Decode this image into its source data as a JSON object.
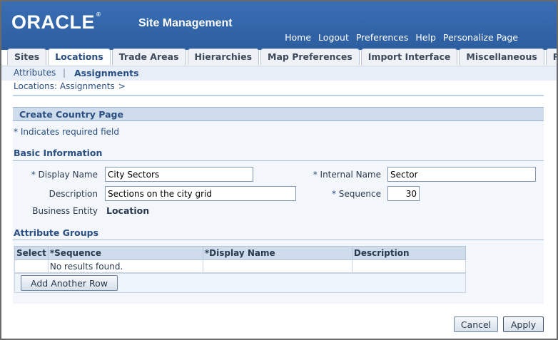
{
  "brand": {
    "logo": "ORACLE",
    "logo_mark": "®",
    "app_title": "Site Management"
  },
  "global_links": [
    "Home",
    "Logout",
    "Preferences",
    "Help",
    "Personalize Page"
  ],
  "tabs": [
    "Sites",
    "Locations",
    "Trade Areas",
    "Hierarchies",
    "Map Preferences",
    "Import Interface",
    "Miscellaneous",
    "Role Securit"
  ],
  "active_tab": "Locations",
  "subtabs": {
    "attributes": "Attributes",
    "separator": "|",
    "assignments": "Assignments"
  },
  "breadcrumb": {
    "link": "Locations: Assignments",
    "separator": ">"
  },
  "panel": {
    "title": "Create Country Page"
  },
  "required_note": "* Indicates required field",
  "basic_info": {
    "title": "Basic Information",
    "display_name": {
      "req": "*",
      "label": "Display Name",
      "value": "City Sectors"
    },
    "internal_name": {
      "req": "*",
      "label": "Internal Name",
      "value": "Sector"
    },
    "description": {
      "label": "Description",
      "value": "Sections on the city grid"
    },
    "sequence": {
      "req": "*",
      "label": "Sequence",
      "value": "30"
    },
    "business_entity": {
      "label": "Business Entity",
      "value": "Location"
    }
  },
  "attribute_groups": {
    "title": "Attribute Groups",
    "columns": [
      "Select",
      "*Sequence",
      "*Display Name",
      "Description"
    ],
    "empty_message": "No results found.",
    "add_row_label": "Add Another Row"
  },
  "actions": {
    "cancel": "Cancel",
    "apply": "Apply"
  }
}
